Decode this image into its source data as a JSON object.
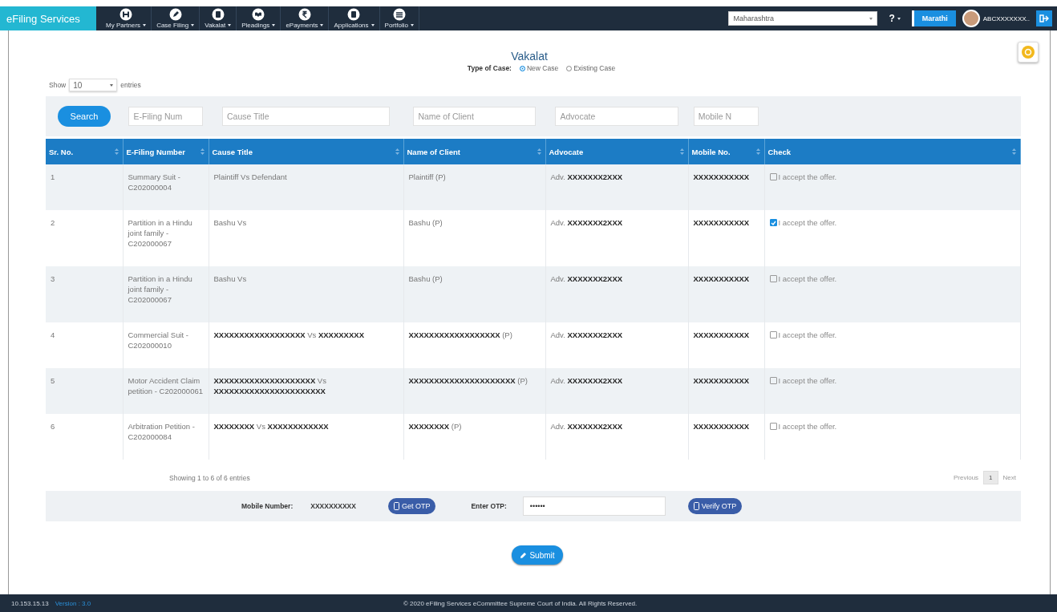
{
  "nav": {
    "brand": "eFiling Services",
    "menus": [
      {
        "label": "My Partners"
      },
      {
        "label": "Case Filing"
      },
      {
        "label": "Vakalat"
      },
      {
        "label": "Pleadings"
      },
      {
        "label": "ePayments"
      },
      {
        "label": "Applications"
      },
      {
        "label": "Portfolio"
      }
    ],
    "state_select": "Maharashtra",
    "help": "?",
    "language": "Marathi",
    "user": "ABCXXXXXXX.."
  },
  "page": {
    "title": "Vakalat",
    "case_type_label": "Type of Case:",
    "case_types": [
      {
        "label": "New Case",
        "selected": true
      },
      {
        "label": "Existing Case",
        "selected": false
      }
    ]
  },
  "length": {
    "show": "Show",
    "value": "10",
    "entries": "entries"
  },
  "filters": {
    "search_button": "Search",
    "fields": [
      {
        "placeholder": "E-Filing Num"
      },
      {
        "placeholder": "Cause Title"
      },
      {
        "placeholder": "Name of Client"
      },
      {
        "placeholder": "Advocate"
      },
      {
        "placeholder": "Mobile N"
      }
    ]
  },
  "table": {
    "columns": [
      "Sr. No.",
      "E-Filing Number",
      "Cause Title",
      "Name of Client",
      "Advocate",
      "Mobile No.",
      "Check"
    ],
    "rows": [
      {
        "sr": "1",
        "efiling_number": "Summary Suit - C202000004",
        "cause_title": "Plaintiff Vs Defendant",
        "client": "Plaintiff (P)",
        "advocate": "Adv. **XXXXXXX2XXX**",
        "mobile": "XXXXXXXXXXX",
        "check": {
          "label": "I accept the offer.",
          "checked": false
        }
      },
      {
        "sr": "2",
        "efiling_number": "Partition in a Hindu joint family - C202000067",
        "cause_title": "Bashu Vs",
        "client": "Bashu (P)",
        "advocate": "Adv. **XXXXXXX2XXX**",
        "mobile": "XXXXXXXXXXX",
        "check": {
          "label": "I accept the offer.",
          "checked": true
        }
      },
      {
        "sr": "3",
        "efiling_number": "Partition in a Hindu joint family - C202000067",
        "cause_title": "Bashu Vs",
        "client": "Bashu (P)",
        "advocate": "Adv. **XXXXXXX2XXX**",
        "mobile": "XXXXXXXXXXX",
        "check": {
          "label": "I accept the offer.",
          "checked": false
        }
      },
      {
        "sr": "4",
        "efiling_number": "Commercial Suit - C202000010",
        "cause_title": "**XXXXXXXXXXXXXXXXXX** Vs **XXXXXXXXX**",
        "client": "**XXXXXXXXXXXXXXXXXX** (P)",
        "advocate": "Adv. **XXXXXXX2XXX**",
        "mobile": "XXXXXXXXXXX",
        "check": {
          "label": "I accept the offer.",
          "checked": false
        }
      },
      {
        "sr": "5",
        "efiling_number": "Motor Accident Claim petition - C202000061",
        "cause_title": "**XXXXXXXXXXXXXXXXXXXX** Vs **XXXXXXXXXXXXXXXXXXXXXX**",
        "client": "**XXXXXXXXXXXXXXXXXXXXX** (P)",
        "advocate": "Adv. **XXXXXXX2XXX**",
        "mobile": "XXXXXXXXXXX",
        "check": {
          "label": "I accept the offer.",
          "checked": false
        }
      },
      {
        "sr": "6",
        "efiling_number": "Arbitration Petition - C202000084",
        "cause_title": "**XXXXXXXX** Vs **XXXXXXXXXXXX**",
        "client": "**XXXXXXXX** (P)",
        "advocate": "Adv. **XXXXXXX2XXX**",
        "mobile": "XXXXXXXXXXX",
        "check": {
          "label": "I accept the offer.",
          "checked": false
        }
      }
    ]
  },
  "info": "Showing 1 to 6 of 6 entries",
  "pagination": {
    "previous": "Previous",
    "pages": [
      {
        "label": "1",
        "selected": true
      }
    ],
    "next": "Next"
  },
  "otp": {
    "mobile_label": "Mobile Number:",
    "mobile_value": "XXXXXXXXXX",
    "get_otp": "Get OTP",
    "otp_label": "Enter OTP:",
    "otp_value": "••••••",
    "verify_otp": "Verify OTP"
  },
  "submit": "Submit",
  "footer": {
    "ip": "10.153.15.13",
    "version": "Version : 3.0",
    "copyright": "© 2020 eFiling Services eCommittee Supreme Court of India. All Rights Reserved."
  }
}
